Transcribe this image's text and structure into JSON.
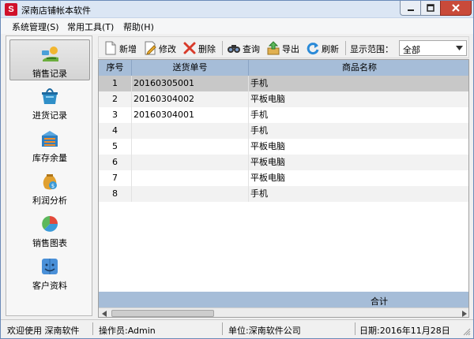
{
  "window": {
    "title": "深南店铺帐本软件",
    "app_icon_letter": "S"
  },
  "menu": [
    {
      "label": "系统管理(S)"
    },
    {
      "label": "常用工具(T)"
    },
    {
      "label": "帮助(H)"
    }
  ],
  "nav": [
    {
      "label": "销售记录",
      "icon": "sales-record-icon",
      "active": true
    },
    {
      "label": "进货记录",
      "icon": "purchase-record-icon"
    },
    {
      "label": "库存余量",
      "icon": "inventory-icon"
    },
    {
      "label": "利润分析",
      "icon": "profit-analysis-icon"
    },
    {
      "label": "销售图表",
      "icon": "pie-chart-icon"
    },
    {
      "label": "客户资料",
      "icon": "customer-info-icon"
    }
  ],
  "toolbar": {
    "add": "新增",
    "edit": "修改",
    "delete": "删除",
    "query": "查询",
    "export": "导出",
    "refresh": "刷新",
    "range_label": "显示范围：",
    "range_value": "全部"
  },
  "grid": {
    "columns": [
      "序号",
      "送货单号",
      "商品名称"
    ],
    "rows": [
      {
        "idx": "1",
        "no": "20160305001",
        "name": "手机"
      },
      {
        "idx": "2",
        "no": "20160304002",
        "name": "平板电脑"
      },
      {
        "idx": "3",
        "no": "20160304001",
        "name": "手机"
      },
      {
        "idx": "4",
        "no": "",
        "name": "手机"
      },
      {
        "idx": "5",
        "no": "",
        "name": "平板电脑"
      },
      {
        "idx": "6",
        "no": "",
        "name": "平板电脑"
      },
      {
        "idx": "7",
        "no": "",
        "name": "平板电脑"
      },
      {
        "idx": "8",
        "no": "",
        "name": "手机"
      }
    ],
    "selected_row": 0,
    "footer_label": "合计"
  },
  "status": {
    "welcome": "欢迎使用 深南软件",
    "operator": "操作员:Admin",
    "company": "单位:深南软件公司",
    "date": "日期:2016年11月28日"
  },
  "colors": {
    "grid_header": "#a6bdd8",
    "selected_row": "#c8c8c8",
    "close_button": "#c94a3a",
    "app_icon": "#d0102a"
  }
}
